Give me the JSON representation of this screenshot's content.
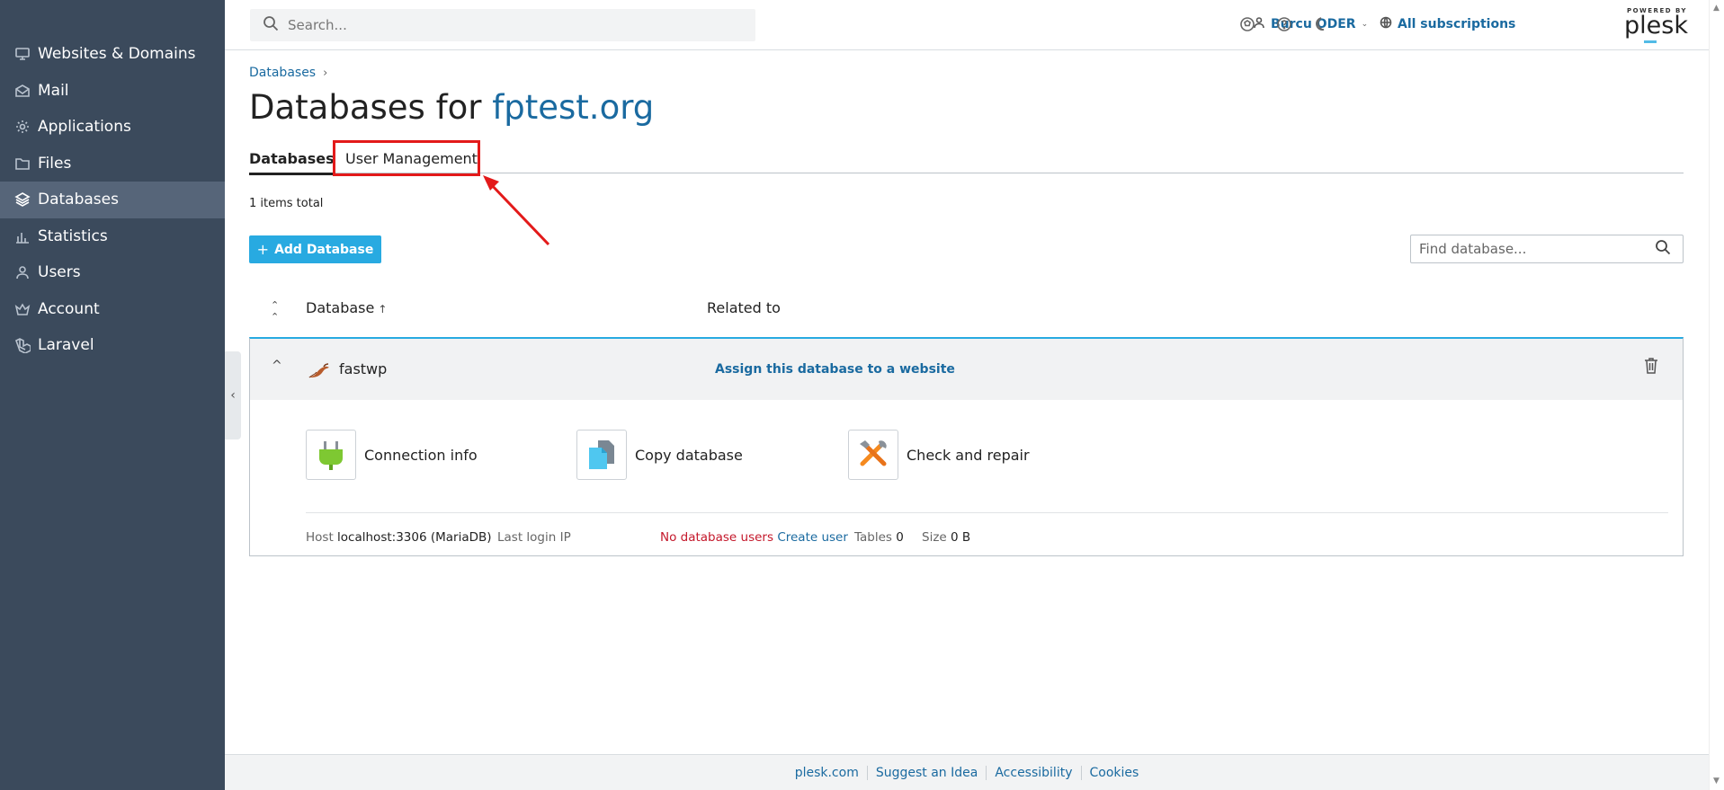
{
  "sidebar": {
    "items": [
      {
        "label": "Websites & Domains",
        "icon": "monitor-icon"
      },
      {
        "label": "Mail",
        "icon": "mail-icon"
      },
      {
        "label": "Applications",
        "icon": "gear-icon"
      },
      {
        "label": "Files",
        "icon": "folder-icon"
      },
      {
        "label": "Databases",
        "icon": "layers-icon",
        "active": true
      },
      {
        "label": "Statistics",
        "icon": "bar-chart-icon"
      },
      {
        "label": "Users",
        "icon": "user-icon"
      },
      {
        "label": "Account",
        "icon": "crown-icon"
      },
      {
        "label": "Laravel",
        "icon": "laravel-icon"
      }
    ],
    "collapse_label": "‹"
  },
  "topbar": {
    "search_placeholder": "Search...",
    "user_name": "Burcu ODER",
    "subscriptions_label": "All subscriptions",
    "brand_powered": "POWERED BY",
    "brand_name": "plesk"
  },
  "main": {
    "breadcrumb": "Databases",
    "breadcrumb_sep": "›",
    "title_prefix": "Databases for ",
    "title_domain": "fptest.org",
    "tabs": [
      {
        "label": "Databases",
        "active": true
      },
      {
        "label": "User Management"
      }
    ],
    "items_total": "1 items total",
    "add_button": "Add Database",
    "find_placeholder": "Find database...",
    "columns": {
      "database": "Database",
      "related": "Related to"
    },
    "database": {
      "name": "fastwp",
      "assign_link": "Assign this database to a website",
      "tools": [
        {
          "label": "Connection info",
          "icon": "plug-icon"
        },
        {
          "label": "Copy database",
          "icon": "copy-icon"
        },
        {
          "label": "Check and repair",
          "icon": "tools-icon"
        }
      ],
      "host_label": "Host",
      "host_value": "localhost:3306 (MariaDB)",
      "last_login_label": "Last login IP",
      "no_users": "No database users",
      "create_user": "Create user",
      "tables_label": "Tables",
      "tables_value": "0",
      "size_label": "Size",
      "size_value": "0 B"
    }
  },
  "footer": {
    "links": [
      "plesk.com",
      "Suggest an Idea",
      "Accessibility",
      "Cookies"
    ]
  },
  "colors": {
    "sidebar_bg": "#3b4a5c",
    "accent": "#28aae1",
    "link": "#1a6aa0",
    "highlight": "#e31a1a",
    "warning": "#c4182b"
  }
}
